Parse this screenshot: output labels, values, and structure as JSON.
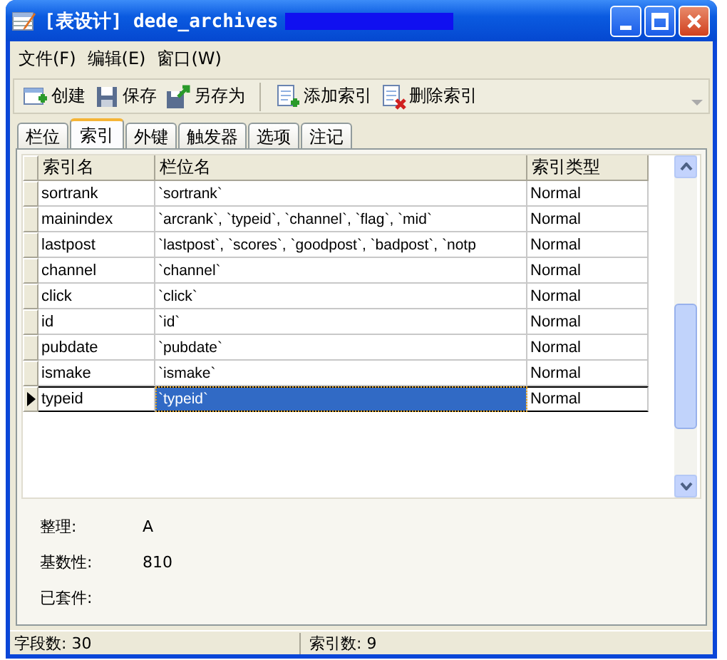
{
  "window": {
    "title": "[表设计] dede_archives"
  },
  "menu": [
    "文件(F)",
    "编辑(E)",
    "窗口(W)"
  ],
  "toolbar": [
    {
      "label": "创建",
      "kind": "create"
    },
    {
      "label": "保存",
      "kind": "save"
    },
    {
      "label": "另存为",
      "kind": "saveas"
    },
    {
      "label": "添加索引",
      "kind": "add",
      "separator_before": true
    },
    {
      "label": "删除索引",
      "kind": "delete"
    }
  ],
  "tabs": [
    {
      "label": "栏位",
      "selected": false
    },
    {
      "label": "索引",
      "selected": true
    },
    {
      "label": "外键",
      "selected": false
    },
    {
      "label": "触发器",
      "selected": false
    },
    {
      "label": "选项",
      "selected": false
    },
    {
      "label": "注记",
      "selected": false
    }
  ],
  "table": {
    "columns": [
      "索引名",
      "栏位名",
      "索引类型"
    ],
    "rows": [
      {
        "cells": [
          "sortrank",
          "`sortrank`",
          "Normal"
        ],
        "selected": false
      },
      {
        "cells": [
          "mainindex",
          "`arcrank`, `typeid`, `channel`, `flag`, `mid`",
          "Normal"
        ],
        "selected": false
      },
      {
        "cells": [
          "lastpost",
          "`lastpost`, `scores`, `goodpost`, `badpost`, `notp",
          "Normal"
        ],
        "selected": false
      },
      {
        "cells": [
          "channel",
          "`channel`",
          "Normal"
        ],
        "selected": false
      },
      {
        "cells": [
          "click",
          "`click`",
          "Normal"
        ],
        "selected": false
      },
      {
        "cells": [
          "id",
          "`id`",
          "Normal"
        ],
        "selected": false
      },
      {
        "cells": [
          "pubdate",
          "`pubdate`",
          "Normal"
        ],
        "selected": false
      },
      {
        "cells": [
          "ismake",
          "`ismake`",
          "Normal"
        ],
        "selected": false
      },
      {
        "cells": [
          "typeid",
          "`typeid`",
          "Normal"
        ],
        "selected": true
      }
    ]
  },
  "details": [
    {
      "label": "整理:",
      "value": "A"
    },
    {
      "label": "基数性:",
      "value": "810"
    },
    {
      "label": "已套件:"
    }
  ],
  "status_bar": [
    "字段数: 30",
    "索引数: 9"
  ]
}
